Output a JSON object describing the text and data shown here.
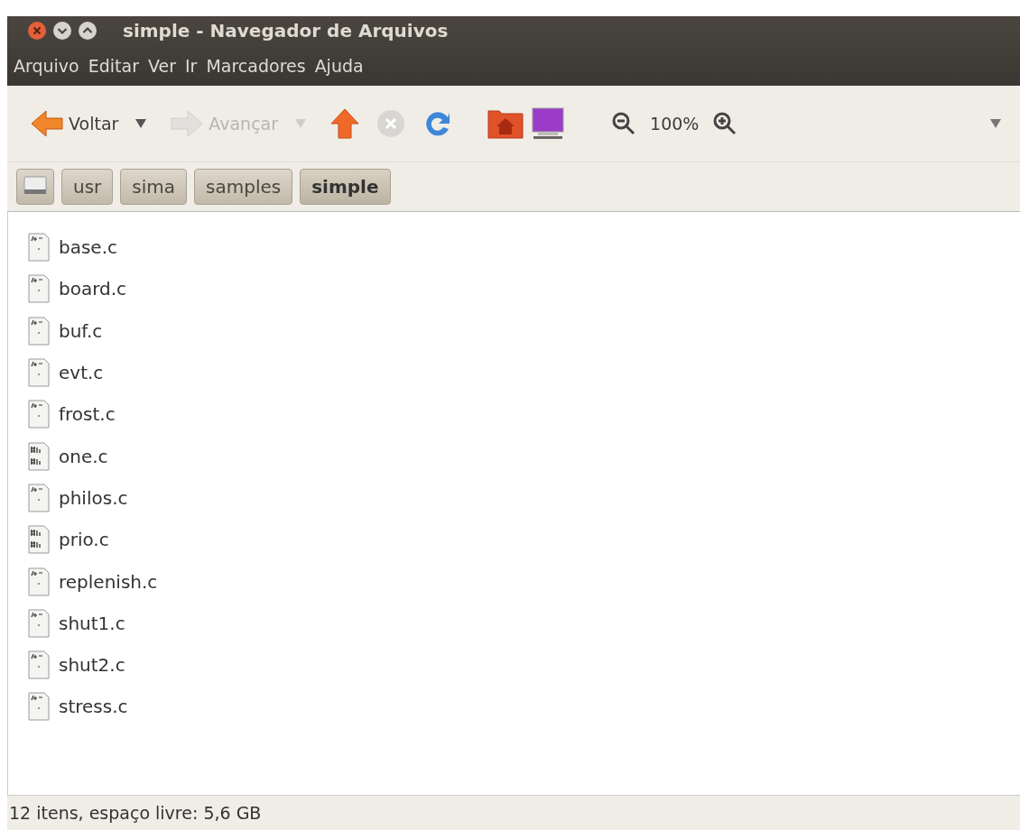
{
  "window": {
    "title": "simple - Navegador de Arquivos"
  },
  "menu": [
    "Arquivo",
    "Editar",
    "Ver",
    "Ir",
    "Marcadores",
    "Ajuda"
  ],
  "toolbar": {
    "back": {
      "label": "Voltar",
      "disabled": false
    },
    "forward": {
      "label": "Avançar",
      "disabled": true
    },
    "stop": {
      "disabled": true
    },
    "zoom": "100%"
  },
  "path": [
    {
      "label": "usr",
      "selected": false
    },
    {
      "label": "sima",
      "selected": false
    },
    {
      "label": "samples",
      "selected": false
    },
    {
      "label": "simple",
      "selected": true
    }
  ],
  "files": [
    {
      "name": "base.c",
      "kind": "source"
    },
    {
      "name": "board.c",
      "kind": "source"
    },
    {
      "name": "buf.c",
      "kind": "source"
    },
    {
      "name": "evt.c",
      "kind": "source"
    },
    {
      "name": "frost.c",
      "kind": "source"
    },
    {
      "name": "one.c",
      "kind": "include"
    },
    {
      "name": "philos.c",
      "kind": "source"
    },
    {
      "name": "prio.c",
      "kind": "include"
    },
    {
      "name": "replenish.c",
      "kind": "source"
    },
    {
      "name": "shut1.c",
      "kind": "source"
    },
    {
      "name": "shut2.c",
      "kind": "source"
    },
    {
      "name": "stress.c",
      "kind": "source"
    }
  ],
  "status_bar": "12 itens, espaço livre: 5,6 GB"
}
